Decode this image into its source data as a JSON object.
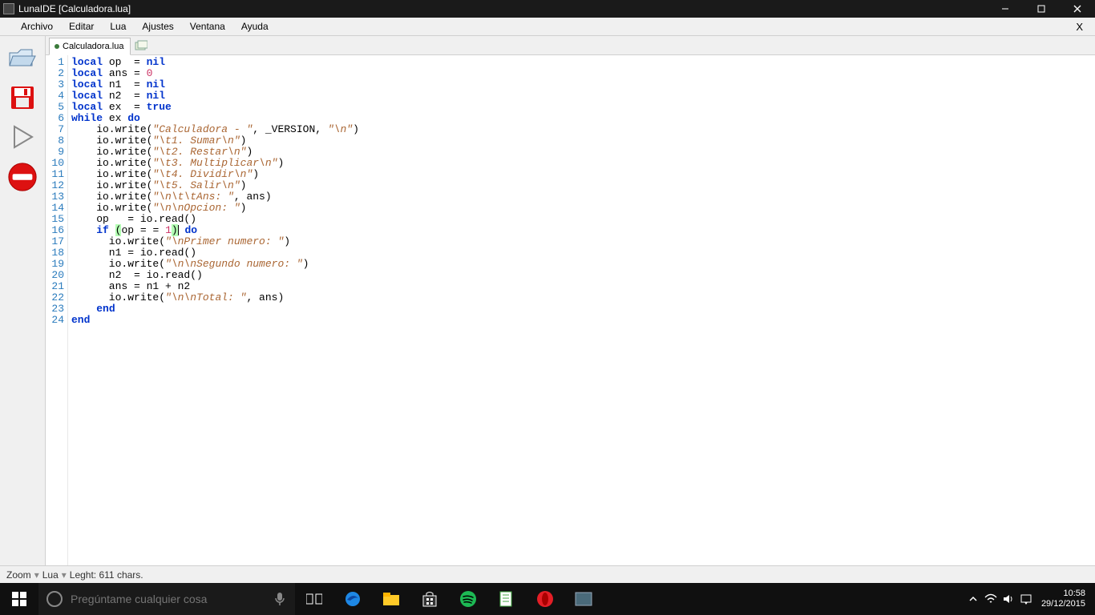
{
  "window": {
    "title": "LunaIDE [Calculadora.lua]"
  },
  "menu": {
    "items": [
      "Archivo",
      "Editar",
      "Lua",
      "Ajustes",
      "Ventana",
      "Ayuda"
    ]
  },
  "tab": {
    "name": "Calculadora.lua"
  },
  "code": {
    "lineCount": 24
  },
  "status": {
    "zoom": "Zoom",
    "lang": "Lua",
    "length": "Leght: 611 chars."
  },
  "taskbar": {
    "search_placeholder": "Pregúntame cualquier cosa",
    "time": "10:58",
    "date": "29/12/2015"
  }
}
